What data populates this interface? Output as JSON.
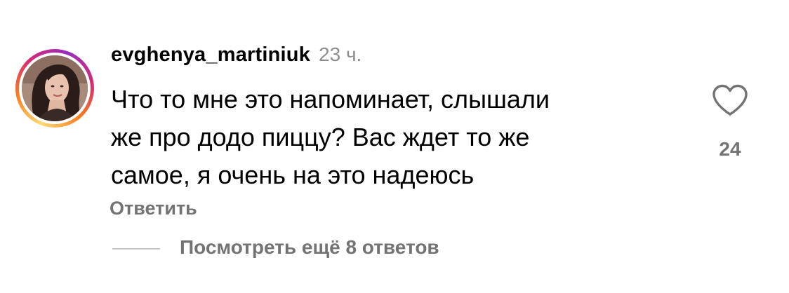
{
  "comment": {
    "username": "evghenya_martiniuk",
    "timestamp": "23 ч.",
    "text_lines": [
      "Что то мне это напоминает, слышали",
      "же про додо пиццу? Вас ждет то же",
      "самое, я очень на это надеюсь"
    ],
    "like_count": "24",
    "reply_label": "Ответить",
    "view_replies_label": "Посмотреть ещё 8 ответов"
  },
  "icons": {
    "like": "heart-outline-icon",
    "avatar": "user-avatar"
  },
  "colors": {
    "primary_text": "#000000",
    "secondary_text": "#737373",
    "timestamp": "#8e8e8e",
    "divider": "#c7c7c7",
    "story_ring": [
      "#feda75",
      "#fa7e1e",
      "#d62976",
      "#962fbf"
    ]
  }
}
